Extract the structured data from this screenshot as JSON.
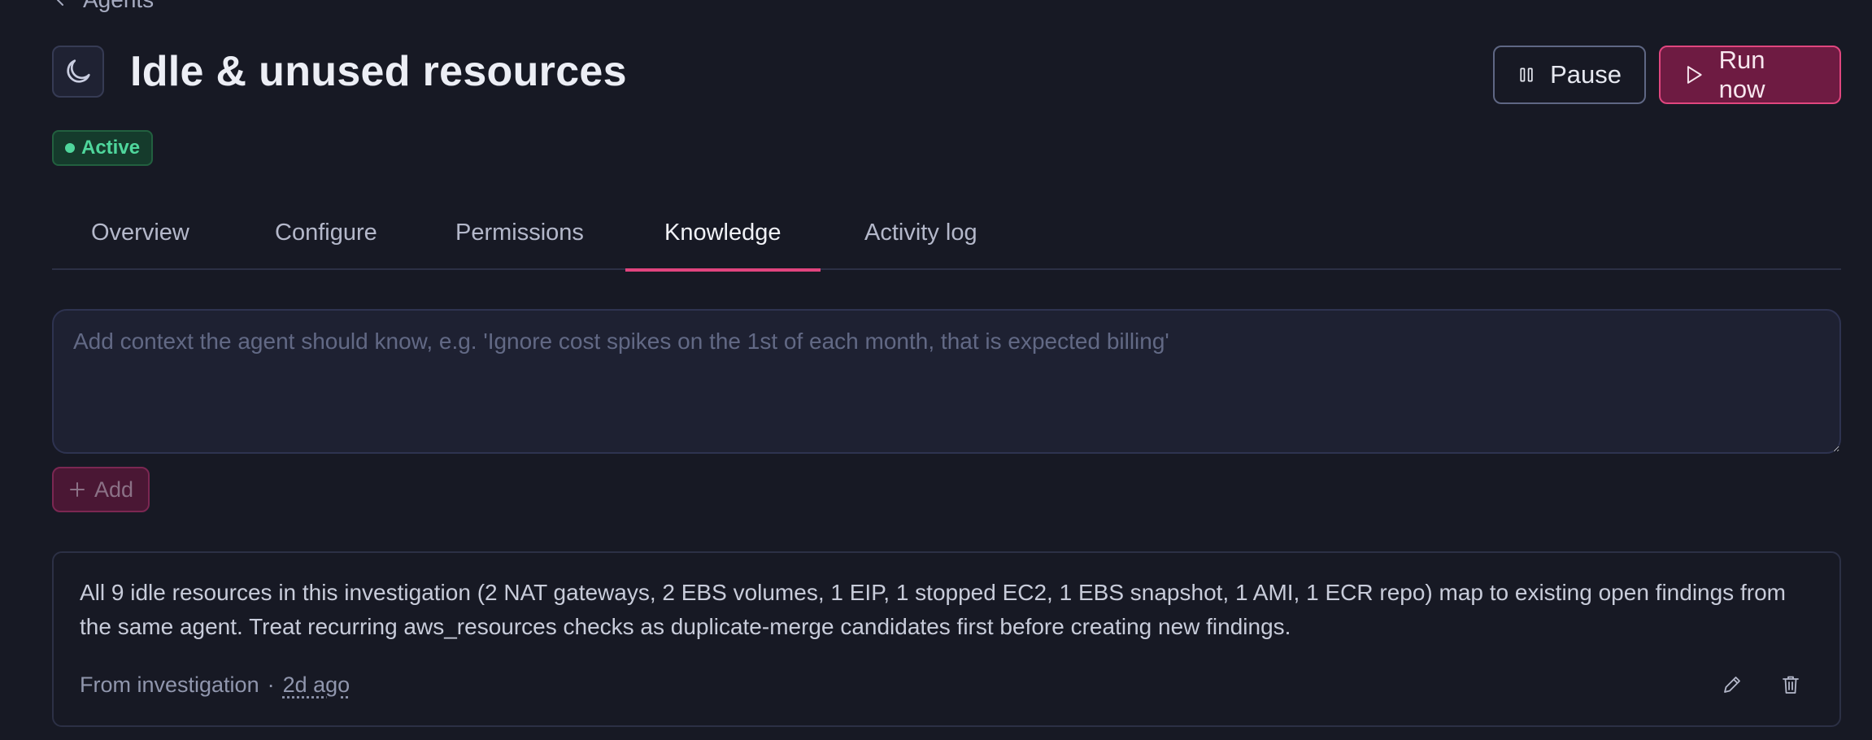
{
  "breadcrumb": {
    "back_label": "Agents"
  },
  "agent": {
    "title": "Idle & unused resources",
    "icon": "moon-icon",
    "status": "Active",
    "status_color": "#4fd69c"
  },
  "actions": {
    "pause_label": "Pause",
    "run_label": "Run now",
    "accent_color": "#e1447e"
  },
  "tabs": [
    {
      "label": "Overview",
      "active": false
    },
    {
      "label": "Configure",
      "active": false
    },
    {
      "label": "Permissions",
      "active": false
    },
    {
      "label": "Knowledge",
      "active": true
    },
    {
      "label": "Activity log",
      "active": false
    }
  ],
  "knowledge": {
    "input_value": "",
    "input_placeholder": "Add context the agent should know, e.g. 'Ignore cost spikes on the 1st of each month, that is expected billing'",
    "add_label": "Add",
    "entries": [
      {
        "text": "All 9 idle resources in this investigation (2 NAT gateways, 2 EBS volumes, 1 EIP, 1 stopped EC2, 1 EBS snapshot, 1 AMI, 1 ECR repo) map to existing open findings from the same agent. Treat recurring aws_resources checks as duplicate-merge candidates first before creating new findings.",
        "source": "From investigation",
        "separator": "·",
        "age": "2d ago"
      }
    ]
  }
}
